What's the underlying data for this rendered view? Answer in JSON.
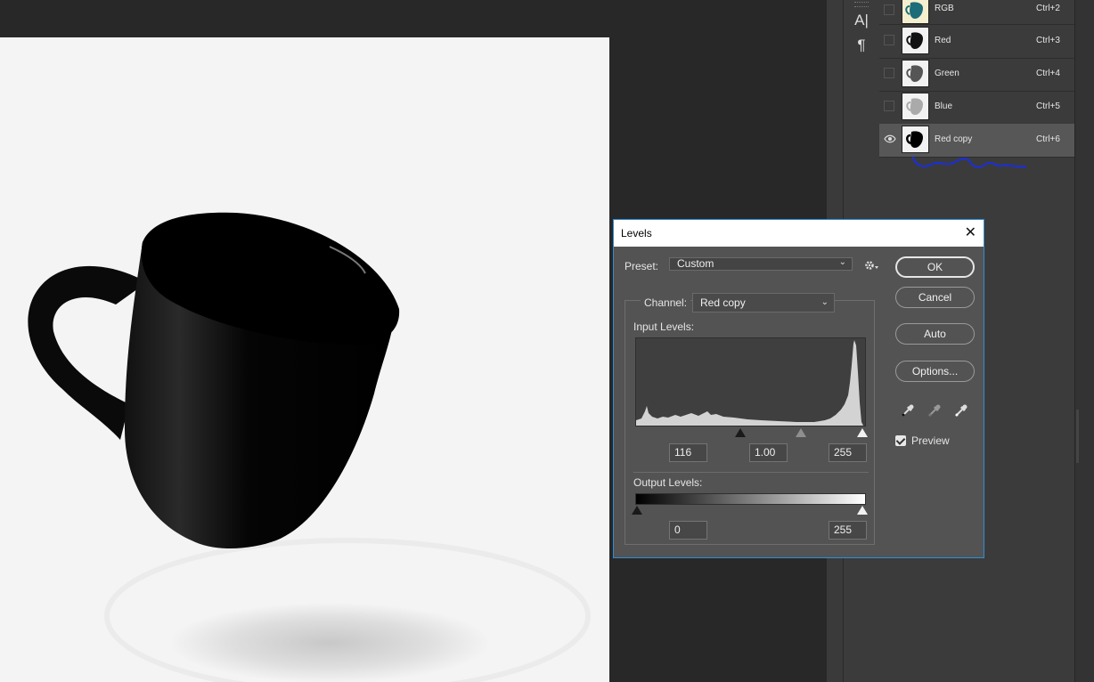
{
  "channels": [
    {
      "name": "RGB",
      "shortcut": "Ctrl+2",
      "visible": false
    },
    {
      "name": "Red",
      "shortcut": "Ctrl+3",
      "visible": false
    },
    {
      "name": "Green",
      "shortcut": "Ctrl+4",
      "visible": false
    },
    {
      "name": "Blue",
      "shortcut": "Ctrl+5",
      "visible": false
    },
    {
      "name": "Red copy",
      "shortcut": "Ctrl+6",
      "visible": true
    }
  ],
  "tools": {
    "type_icon": "A|",
    "paragraph_icon": "¶"
  },
  "dialog": {
    "title": "Levels",
    "close_glyph": "✕",
    "preset_label": "Preset:",
    "preset_value": "Custom",
    "channel_label": "Channel:",
    "channel_value": "Red copy",
    "input_levels_label": "Input Levels:",
    "input_black": "116",
    "input_gamma": "1.00",
    "input_white": "255",
    "output_levels_label": "Output Levels:",
    "output_black": "0",
    "output_white": "255",
    "ok_label": "OK",
    "cancel_label": "Cancel",
    "auto_label": "Auto",
    "options_label": "Options...",
    "preview_label": "Preview",
    "preview_checked": true
  },
  "colors": {
    "accent": "#2e8fd8",
    "annotation": "#1a2ee0"
  }
}
